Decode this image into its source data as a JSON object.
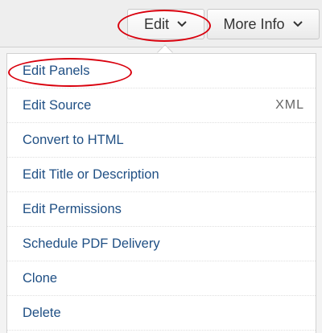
{
  "toolbar": {
    "edit_label": "Edit",
    "more_info_label": "More Info"
  },
  "menu": {
    "items": [
      {
        "label": "Edit Panels",
        "hint": ""
      },
      {
        "label": "Edit Source",
        "hint": "XML"
      },
      {
        "label": "Convert to HTML",
        "hint": ""
      },
      {
        "label": "Edit Title or Description",
        "hint": ""
      },
      {
        "label": "Edit Permissions",
        "hint": ""
      },
      {
        "label": "Schedule PDF Delivery",
        "hint": ""
      },
      {
        "label": "Clone",
        "hint": ""
      },
      {
        "label": "Delete",
        "hint": ""
      }
    ]
  },
  "colors": {
    "link": "#1f4f84",
    "annotation": "#d9000d"
  },
  "icons": {
    "dropdown": "chevron-down-icon"
  }
}
